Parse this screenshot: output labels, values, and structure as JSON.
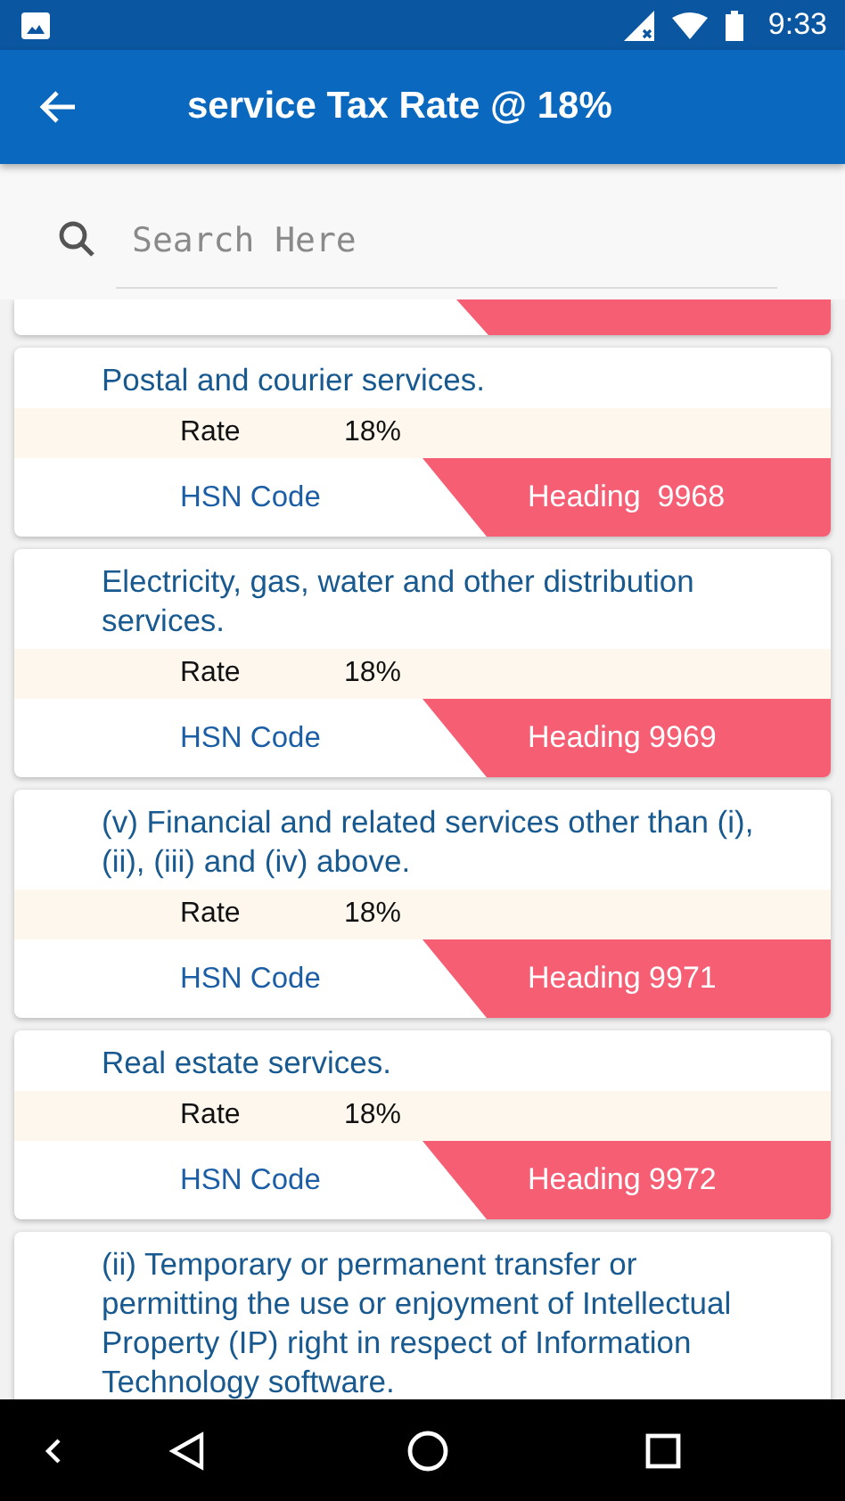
{
  "status_bar": {
    "time": "9:33"
  },
  "app_bar": {
    "title": "service Tax Rate @ 18%"
  },
  "search": {
    "placeholder": "Search Here"
  },
  "cards": [
    {
      "kind": "fragment"
    },
    {
      "kind": "full",
      "title": "Postal and courier services.",
      "rate_label": "Rate",
      "rate": "18%",
      "hsn_label": "HSN Code",
      "heading": "Heading  9968"
    },
    {
      "kind": "full",
      "title": "Electricity, gas, water and other distribution services.",
      "rate_label": "Rate",
      "rate": "18%",
      "hsn_label": "HSN Code",
      "heading": "Heading 9969"
    },
    {
      "kind": "full",
      "title": "(v) Financial and related services other than (i), (ii), (iii) and (iv) above.",
      "rate_label": "Rate",
      "rate": "18%",
      "hsn_label": "HSN Code",
      "heading": "Heading 9971"
    },
    {
      "kind": "full",
      "title": "Real estate services.",
      "rate_label": "Rate",
      "rate": "18%",
      "hsn_label": "HSN Code",
      "heading": "Heading 9972"
    },
    {
      "kind": "cut",
      "title": "(ii) Temporary or permanent transfer or permitting the use or enjoyment of Intellectual Property (IP) right in respect of Information Technology software."
    }
  ]
}
